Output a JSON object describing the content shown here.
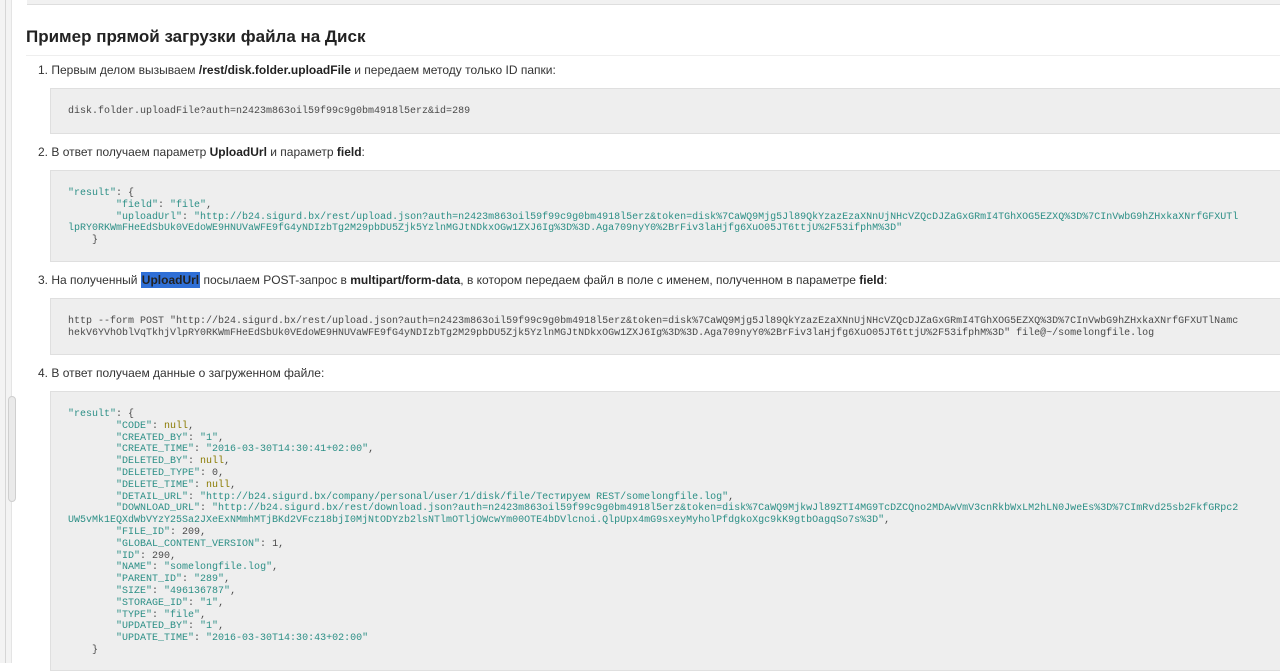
{
  "title": "Пример прямой загрузки файла на Диск",
  "steps": [
    {
      "num": "1.",
      "pre": " Первым делом вызываем ",
      "bold": "/rest/disk.folder.uploadFile",
      "post": " и передаем методу только ID папки:"
    },
    {
      "num": "2.",
      "pre": " В ответ получаем параметр ",
      "bold1": "UploadUrl",
      "mid": " и параметр ",
      "bold2": "field",
      "post": ":"
    },
    {
      "num": "3.",
      "pre": " На полученный ",
      "highlight": "UploadUrl",
      "mid1": " посылаем POST-запрос в ",
      "bold1": "multipart/form-data",
      "mid2": ", в котором передаем файл в поле с именем, полученном в параметре ",
      "bold2": "field",
      "post": ":"
    },
    {
      "num": "4.",
      "text": " В ответ получаем данные о загруженном файле:"
    }
  ],
  "code1": "disk.folder.uploadFile?auth=n2423m863oil59f99c9g0bm4918l5erz&id=289",
  "code2": {
    "l1": "\"result\"",
    "l1b": ": {",
    "field_key": "\"field\"",
    "field_val": "\"file\"",
    "upload_key": "\"uploadUrl\"",
    "upload_val_1": "\"http://b24.sigurd.bx/rest/upload.json?auth=n2423m863oil59f99c9g0bm4918l5erz&token=disk%7CaWQ9Mjg5Jl89QkYzazEzaXNnUjNHcVZQcDJZaGxGRmI4TGhXOG5EZXQ%3D%7CInVwbG9hZHxkaXNrfGFXUTl",
    "upload_val_2": "lpRY0RKWmFHeEdSbUk0VEdoWE9HNUVaWFE9fG4yNDIzbTg2M29pbDU5Zjk5YzlnMGJtNDkxOGw1ZXJ6Ig%3D%3D.Aga709nyY0%2BrFiv3laHjfg6XuO05JT6ttjU%2F53ifphM%3D\"",
    "close": "}"
  },
  "code3": {
    "line1": "http --form POST \"http://b24.sigurd.bx/rest/upload.json?auth=n2423m863oil59f99c9g0bm4918l5erz&token=disk%7CaWQ9Mjg5Jl89QkYzazEzaXNnUjNHcVZQcDJZaGxGRmI4TGhXOG5EZXQ%3D%7CInVwbG9hZHxkaXNrfGFXUTlNamc",
    "line2": "hekV6YVhOblVqTkhjVlpRY0RKWmFHeEdSbUk0VEdoWE9HNUVaWFE9fG4yNDIzbTg2M29pbDU5Zjk5YzlnMGJtNDkxOGw1ZXJ6Ig%3D%3D.Aga709nyY0%2BrFiv3laHjfg6XuO05JT6ttjU%2F53ifphM%3D\" file@~/somelongfile.log"
  },
  "code4": {
    "result_key": "\"result\"",
    "open": ": {",
    "rows": [
      {
        "k": "\"CODE\"",
        "v": "null",
        "t": "kw"
      },
      {
        "k": "\"CREATED_BY\"",
        "v": "\"1\"",
        "t": "str"
      },
      {
        "k": "\"CREATE_TIME\"",
        "v": "\"2016-03-30T14:30:41+02:00\"",
        "t": "str"
      },
      {
        "k": "\"DELETED_BY\"",
        "v": "null",
        "t": "kw"
      },
      {
        "k": "\"DELETED_TYPE\"",
        "v": "0",
        "t": "num"
      },
      {
        "k": "\"DELETE_TIME\"",
        "v": "null",
        "t": "kw"
      },
      {
        "k": "\"DETAIL_URL\"",
        "v": "\"http://b24.sigurd.bx/company/personal/user/1/disk/file/Тестируем REST/somelongfile.log\"",
        "t": "str"
      },
      {
        "k": "\"DOWNLOAD_URL\"",
        "v": "\"http://b24.sigurd.bx/rest/download.json?auth=n2423m863oil59f99c9g0bm4918l5erz&token=disk%7CaWQ9MjkwJl89ZTI4MG9TcDZCQno2MDAwVmV3cnRkbWxLM2hLN0JweEs%3D%7CImRvd25sb2FkfGRpc2",
        "t": "str"
      },
      {
        "k": "",
        "v": "UW5vMk1EQXdWbVYzY25Sa2JXeExNMmhMTjBKd2VFcz18bjI0MjNtODYzb2lsNTlmOTljOWcwYm00OTE4bDVlcnoi.QlpUpx4mG9sxeyMyholPfdgkoXgc9kK9gtbOagqSo7s%3D\"",
        "t": "str",
        "wrap": true
      },
      {
        "k": "\"FILE_ID\"",
        "v": "209",
        "t": "num"
      },
      {
        "k": "\"GLOBAL_CONTENT_VERSION\"",
        "v": "1",
        "t": "num"
      },
      {
        "k": "\"ID\"",
        "v": "290",
        "t": "num"
      },
      {
        "k": "\"NAME\"",
        "v": "\"somelongfile.log\"",
        "t": "str"
      },
      {
        "k": "\"PARENT_ID\"",
        "v": "\"289\"",
        "t": "str"
      },
      {
        "k": "\"SIZE\"",
        "v": "\"496136787\"",
        "t": "str"
      },
      {
        "k": "\"STORAGE_ID\"",
        "v": "\"1\"",
        "t": "str"
      },
      {
        "k": "\"TYPE\"",
        "v": "\"file\"",
        "t": "str"
      },
      {
        "k": "\"UPDATED_BY\"",
        "v": "\"1\"",
        "t": "str"
      },
      {
        "k": "\"UPDATE_TIME\"",
        "v": "\"2016-03-30T14:30:43+02:00\"",
        "t": "str",
        "last": true
      }
    ],
    "close": "}"
  }
}
